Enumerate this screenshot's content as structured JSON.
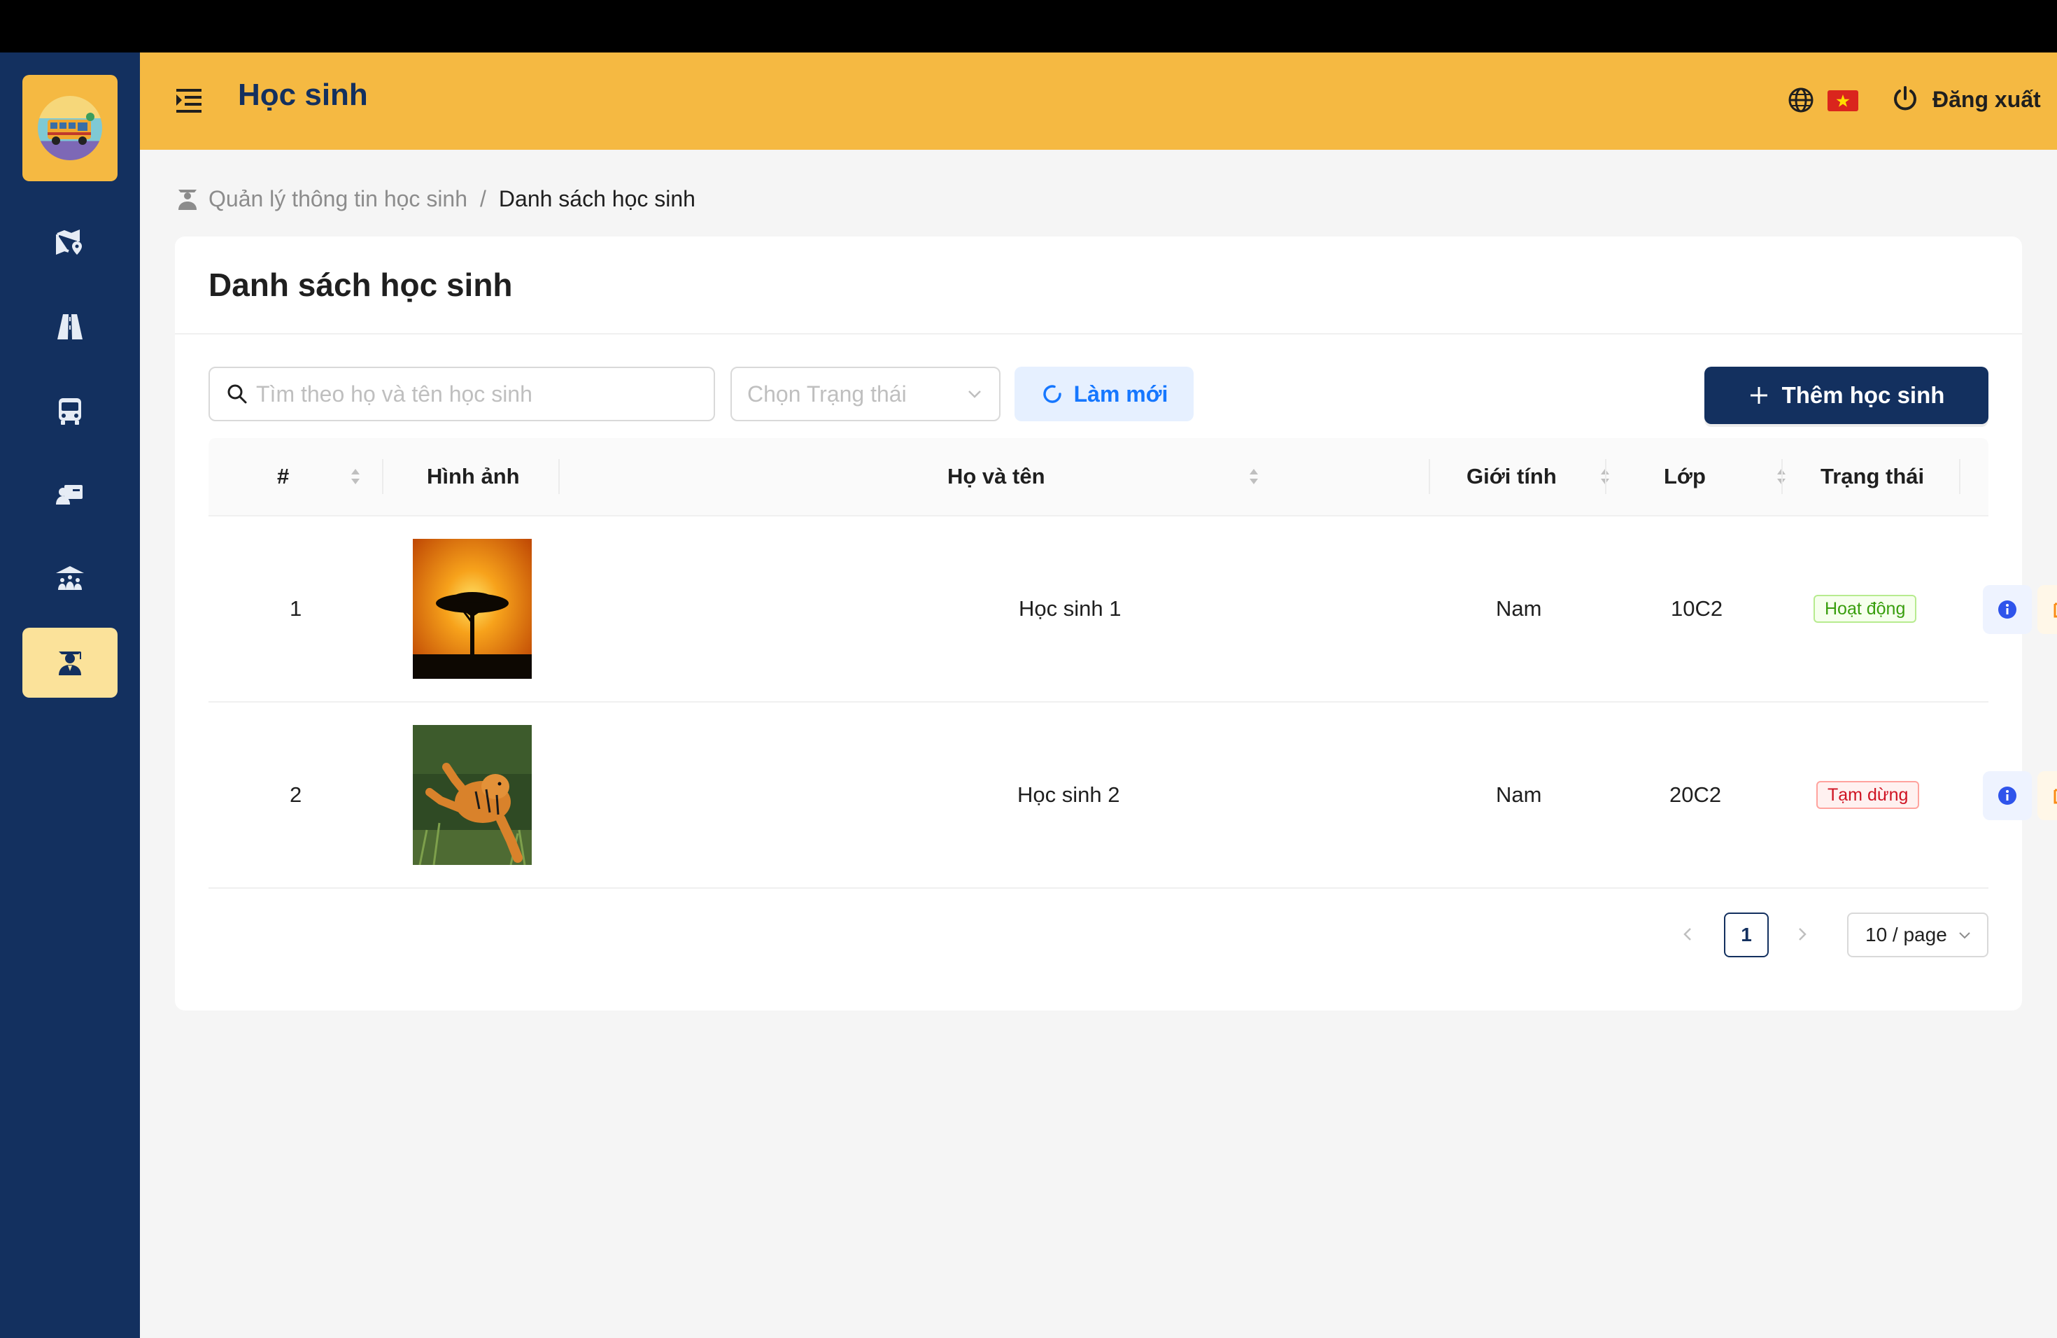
{
  "header": {
    "title": "Học sinh",
    "logout_label": "Đăng xuất"
  },
  "sidebar": {
    "items": [
      {
        "name": "map-pin-icon"
      },
      {
        "name": "road-icon"
      },
      {
        "name": "bus-icon"
      },
      {
        "name": "teacher-icon"
      },
      {
        "name": "school-icon"
      },
      {
        "name": "student-icon",
        "active": true
      }
    ]
  },
  "breadcrumb": {
    "parent": "Quản lý thông tin học sinh",
    "separator": "/",
    "current": "Danh sách học sinh"
  },
  "card": {
    "title": "Danh sách học sinh"
  },
  "toolbar": {
    "search_placeholder": "Tìm theo họ và tên học sinh",
    "status_placeholder": "Chọn Trạng thái",
    "refresh_label": "Làm mới",
    "add_label": "Thêm học sinh"
  },
  "table": {
    "columns": [
      "#",
      "Hình ảnh",
      "Họ và tên",
      "Giới tính",
      "Lớp",
      "Trạng thái"
    ],
    "rows": [
      {
        "index": "1",
        "name": "Học sinh 1",
        "gender": "Nam",
        "class": "10C2",
        "status": "Hoạt động",
        "status_type": "active"
      },
      {
        "index": "2",
        "name": "Học sinh 2",
        "gender": "Nam",
        "class": "20C2",
        "status": "Tạm dừng",
        "status_type": "paused"
      }
    ]
  },
  "pagination": {
    "current_page": "1",
    "page_size": "10 / page"
  },
  "colors": {
    "primary": "#13305f",
    "accent": "#f5b942",
    "active_tag": "#389e0d",
    "paused_tag": "#cf1322"
  }
}
